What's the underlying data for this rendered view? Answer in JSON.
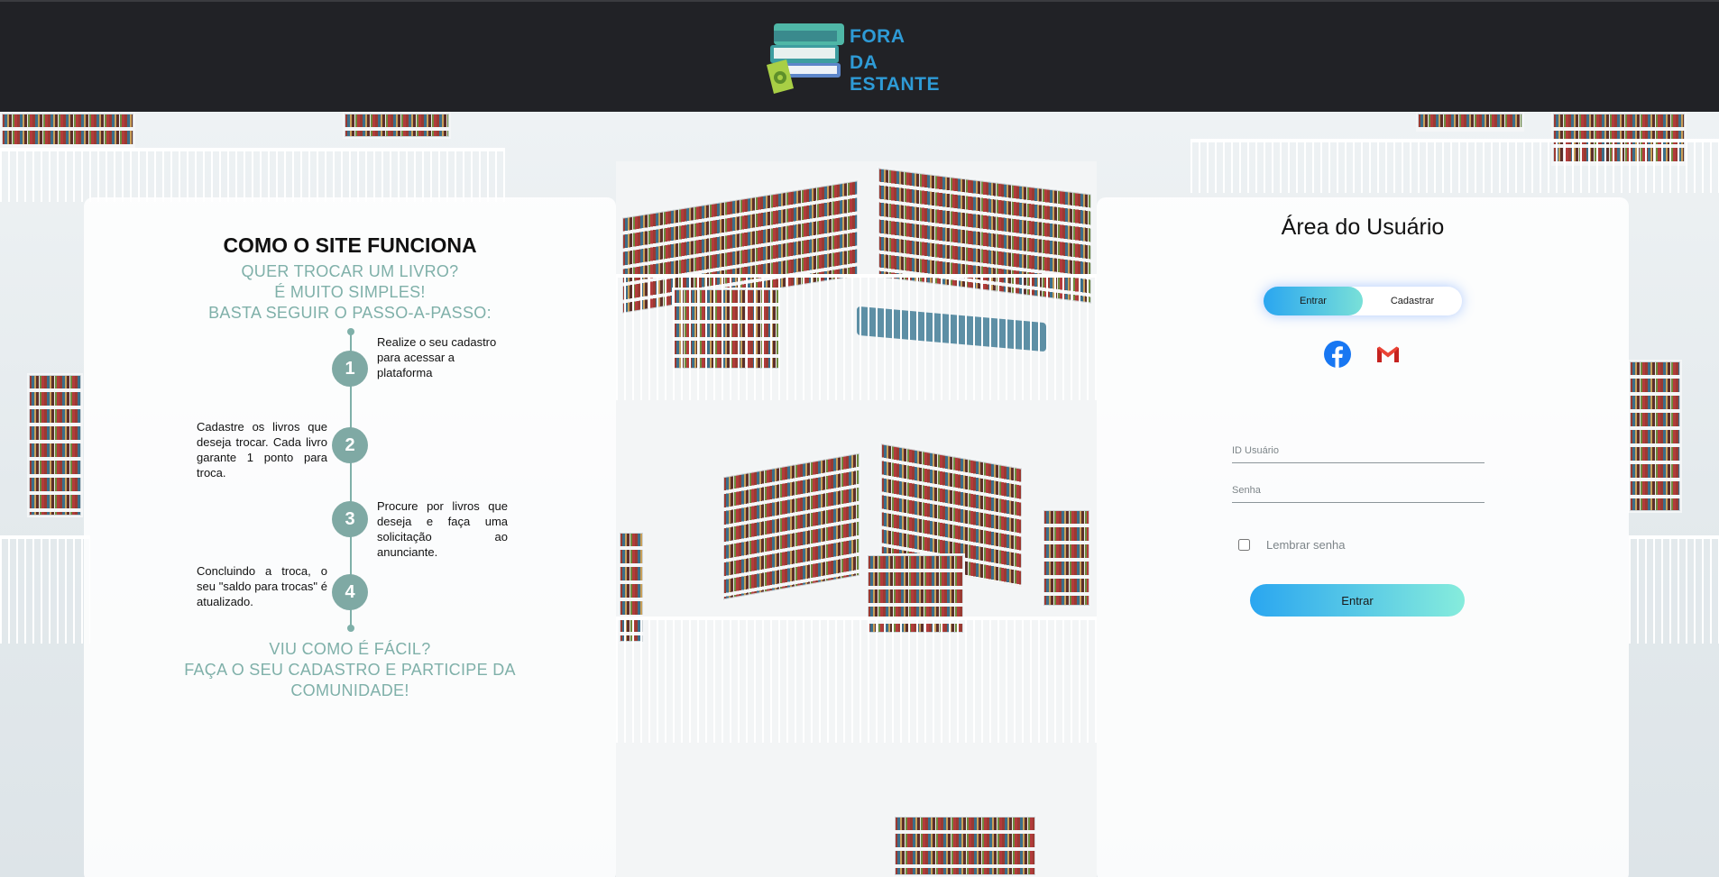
{
  "header": {
    "logo_line1": "FORA",
    "logo_line2": "DA ESTANTE"
  },
  "how_it_works": {
    "title": "COMO O SITE FUNCIONA",
    "intro": [
      "QUER TROCAR UM LIVRO?",
      "É MUITO SIMPLES!",
      "BASTA SEGUIR O PASSO-A-PASSO:"
    ],
    "steps": [
      {
        "number": "1",
        "text": "Realize o seu cadastro para acessar a plataforma"
      },
      {
        "number": "2",
        "text": "Cadastre os livros que deseja trocar. Cada livro garante 1 ponto para troca."
      },
      {
        "number": "3",
        "text": "Procure por livros que deseja e faça uma solicitação ao anunciante."
      },
      {
        "number": "4",
        "text": "Concluindo a troca, o seu \"saldo para trocas\" é atualizado."
      }
    ],
    "outro": [
      "VIU COMO É FÁCIL?",
      "FAÇA O SEU CADASTRO E PARTICIPE DA",
      "COMUNIDADE!"
    ]
  },
  "user_area": {
    "title": "Área do Usuário",
    "tabs": {
      "login": "Entrar",
      "signup": "Cadastrar"
    },
    "social": {
      "facebook_icon": "facebook-icon",
      "gmail_icon": "gmail-icon"
    },
    "user_id_placeholder": "ID Usuário",
    "password_placeholder": "Senha",
    "remember_label": "Lembrar senha",
    "submit_label": "Entrar"
  },
  "colors": {
    "header_bg": "#212226",
    "accent_teal": "#7fb0a9",
    "gradient_start": "#2aa6f0",
    "gradient_end": "#86ecdc"
  }
}
